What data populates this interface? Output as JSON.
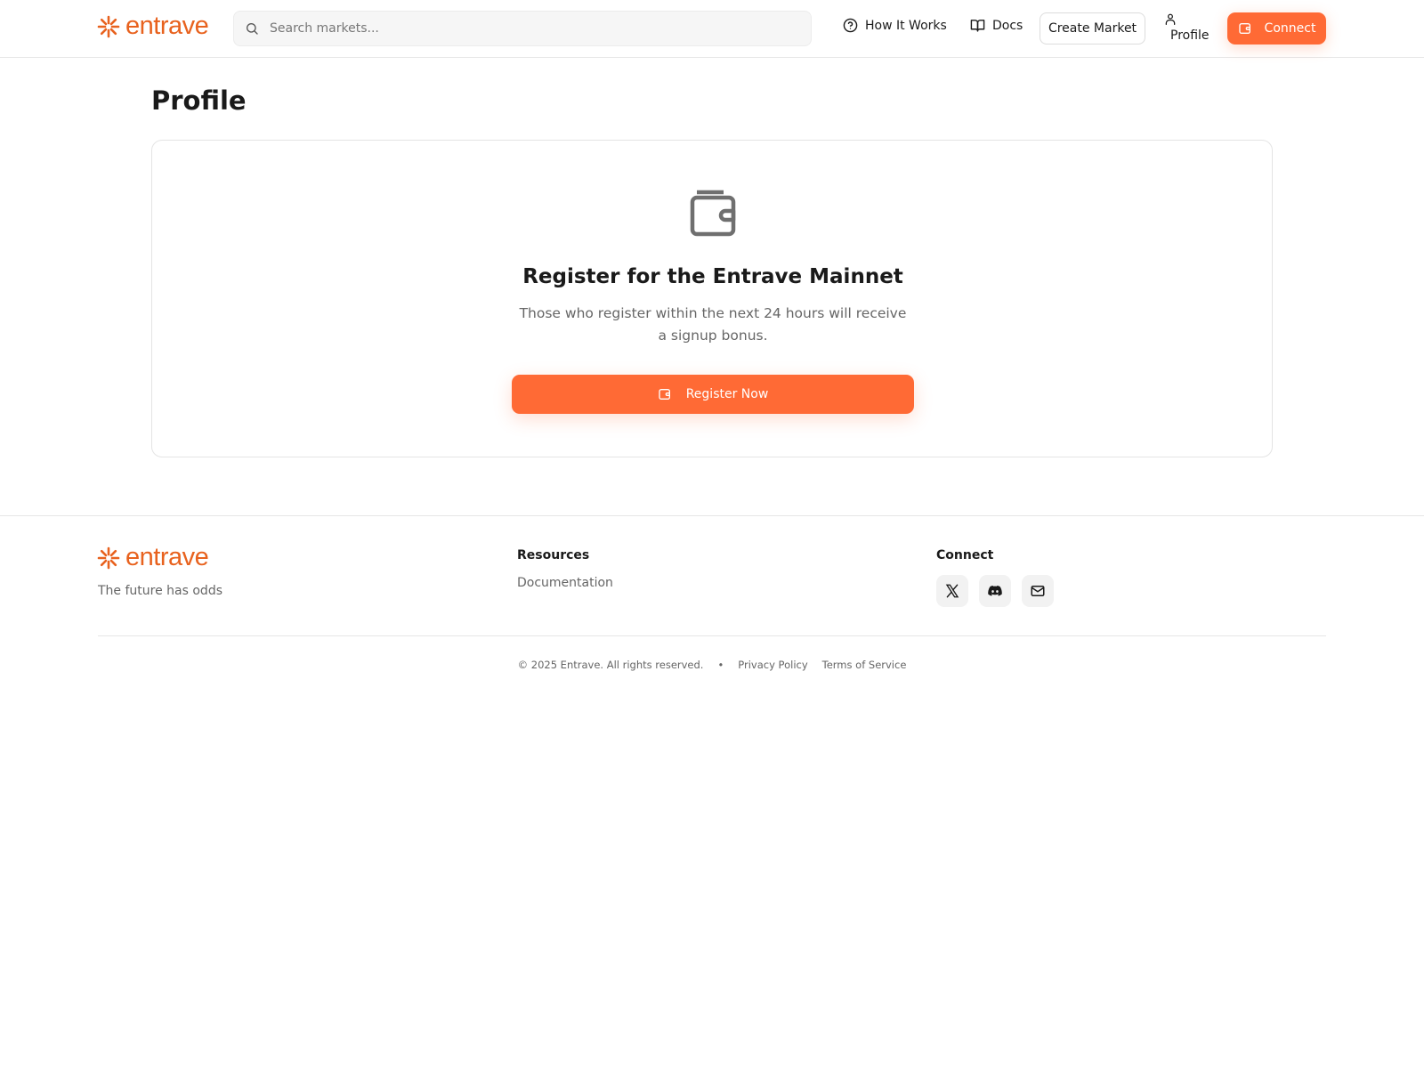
{
  "brand": {
    "name": "entrave",
    "tagline": "The future has odds",
    "accent": "#ff6a35",
    "logo_color": "#e8621e"
  },
  "header": {
    "search_placeholder": "Search markets...",
    "search_icon": "search-icon",
    "how_it_works": "How It Works",
    "how_it_works_icon": "help-circle-icon",
    "docs": "Docs",
    "docs_icon": "book-open-icon",
    "create_market": "Create Market",
    "profile": "Profile",
    "profile_icon": "user-icon",
    "connect": "Connect",
    "connect_icon": "wallet-icon"
  },
  "main": {
    "page_title": "Profile",
    "card": {
      "icon": "wallet-icon",
      "title": "Register for the Entrave Mainnet",
      "description": "Those who register within the next 24 hours will receive a signup bonus.",
      "register_button": "Register Now"
    }
  },
  "footer": {
    "resources_heading": "Resources",
    "resources": [
      "Documentation"
    ],
    "connect_heading": "Connect",
    "social_icons": [
      "x-icon",
      "discord-icon",
      "mail-icon"
    ],
    "copyright": "© 2025 Entrave. All rights reserved.",
    "separator": "•",
    "privacy": "Privacy Policy",
    "terms": "Terms of Service"
  }
}
